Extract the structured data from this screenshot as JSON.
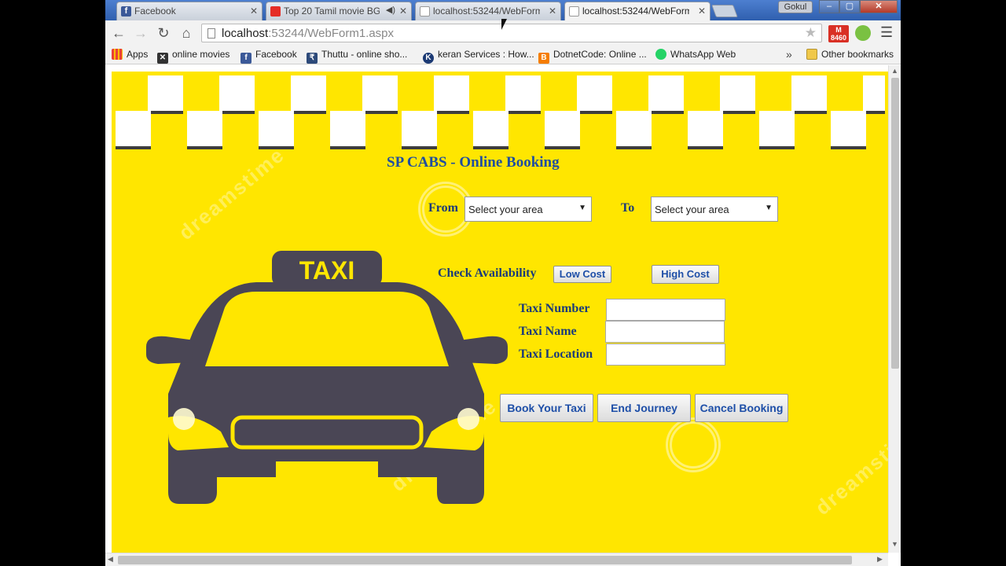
{
  "browser": {
    "tabs": [
      {
        "label": "Facebook",
        "icon": "facebook-icon"
      },
      {
        "label": "Top 20 Tamil movie BG",
        "icon": "youtube-icon"
      },
      {
        "label": "localhost:53244/WebForm",
        "icon": "page-icon"
      },
      {
        "label": "localhost:53244/WebForm",
        "icon": "page-icon",
        "active": true
      }
    ],
    "user": "Gokul",
    "url_host": "localhost",
    "url_rest": ":53244/WebForm1.aspx",
    "gmail_badge": "8460",
    "bookmarks": [
      {
        "label": "Apps",
        "icon": "apps-icon"
      },
      {
        "label": "online movies",
        "icon": "x-icon"
      },
      {
        "label": "Facebook",
        "icon": "facebook-icon"
      },
      {
        "label": "Thuttu - online sho...",
        "icon": "rupee-icon"
      },
      {
        "label": "keran Services : How...",
        "icon": "k-icon"
      },
      {
        "label": "DotnetCode: Online ...",
        "icon": "blogger-icon"
      },
      {
        "label": "WhatsApp Web",
        "icon": "whatsapp-icon"
      }
    ],
    "other_bookmarks": "Other bookmarks",
    "chevron": "»"
  },
  "page": {
    "heading": "SP CABS - Online Booking",
    "from_label": "From",
    "to_label": "To",
    "from_select": "Select your area",
    "to_select": "Select your area",
    "check_availability": "Check Availability",
    "low_cost": "Low Cost",
    "high_cost": "High Cost",
    "taxi_number_label": "Taxi Number",
    "taxi_name_label": "Taxi Name",
    "taxi_location_label": "Taxi Location",
    "book_button": "Book Your Taxi",
    "end_button": "End Journey",
    "cancel_button": "Cancel Booking",
    "taxi_sign": "TAXI",
    "watermark": "dreamstime"
  },
  "colors": {
    "background": "#ffe600",
    "heading": "#1f4ea0",
    "car_body": "#4a4655"
  }
}
